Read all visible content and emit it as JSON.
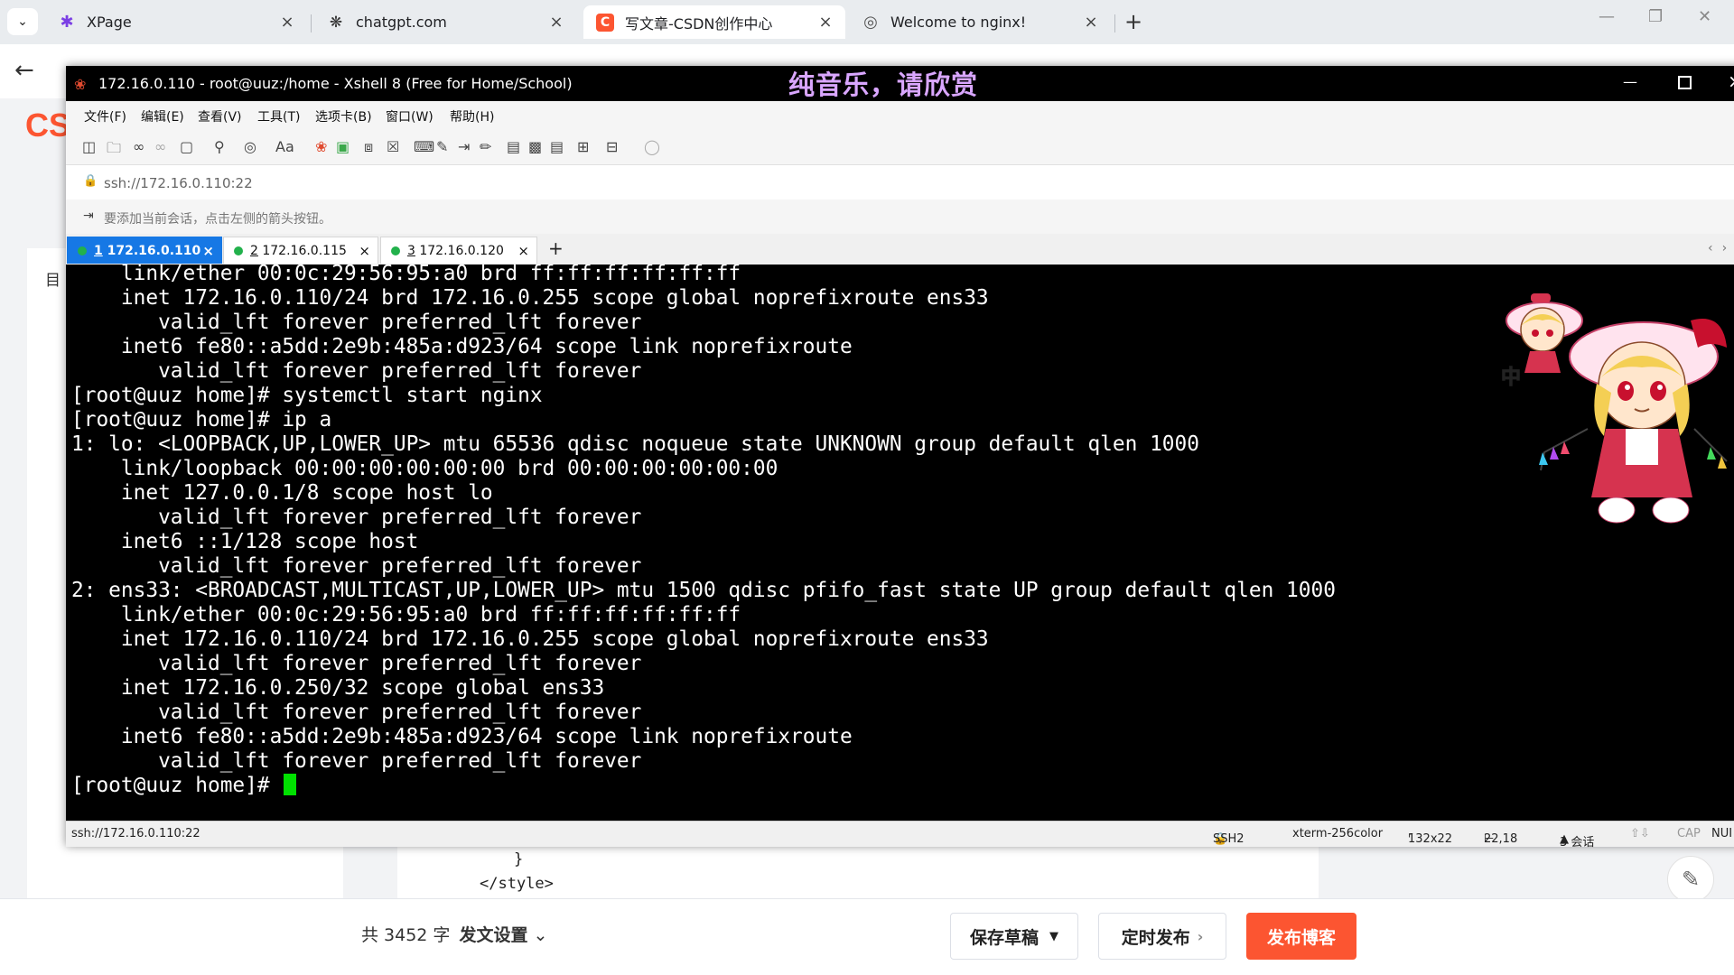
{
  "browser": {
    "tabs": [
      {
        "label": "XPage",
        "icon": "xpage-icon",
        "active": false
      },
      {
        "label": "chatgpt.com",
        "icon": "chatgpt-icon",
        "active": false
      },
      {
        "label": "写文章-CSDN创作中心",
        "icon": "csdn-icon",
        "active": true
      },
      {
        "label": "Welcome to nginx!",
        "icon": "globe-icon",
        "active": false
      }
    ],
    "new_tab": "+"
  },
  "csdn": {
    "logo": "CS",
    "side_label": "目",
    "code_lines": [
      "}",
      "</style>"
    ],
    "footer": {
      "word_count": "共 3452 字",
      "settings": "发文设置",
      "save_draft": "保存草稿",
      "schedule": "定时发布",
      "publish": "发布博客"
    },
    "colors": {
      "brand": "#fc5531"
    }
  },
  "xshell": {
    "title": "172.16.0.110 - root@uuz:/home - Xshell 8 (Free for Home/School)",
    "banner": "纯音乐，请欣赏",
    "menu": [
      "文件(F)",
      "编辑(E)",
      "查看(V)",
      "工具(T)",
      "选项卡(B)",
      "窗口(W)",
      "帮助(H)"
    ],
    "address": "ssh://172.16.0.110:22",
    "hint": "要添加当前会话，点击左侧的箭头按钮。",
    "tabs": [
      {
        "num": "1",
        "label": " 172.16.0.110",
        "active": true
      },
      {
        "num": "2",
        "label": " 172.16.0.115",
        "active": false
      },
      {
        "num": "3",
        "label": " 172.16.0.120",
        "active": false
      }
    ],
    "terminal_lines": [
      "    link/ether 00:0c:29:56:95:a0 brd ff:ff:ff:ff:ff:ff",
      "    inet 172.16.0.110/24 brd 172.16.0.255 scope global noprefixroute ens33",
      "       valid_lft forever preferred_lft forever",
      "    inet6 fe80::a5dd:2e9b:485a:d923/64 scope link noprefixroute",
      "       valid_lft forever preferred_lft forever",
      "[root@uuz home]# systemctl start nginx",
      "[root@uuz home]# ip a",
      "1: lo: <LOOPBACK,UP,LOWER_UP> mtu 65536 qdisc noqueue state UNKNOWN group default qlen 1000",
      "    link/loopback 00:00:00:00:00:00 brd 00:00:00:00:00:00",
      "    inet 127.0.0.1/8 scope host lo",
      "       valid_lft forever preferred_lft forever",
      "    inet6 ::1/128 scope host",
      "       valid_lft forever preferred_lft forever",
      "2: ens33: <BROADCAST,MULTICAST,UP,LOWER_UP> mtu 1500 qdisc pfifo_fast state UP group default qlen 1000",
      "    link/ether 00:0c:29:56:95:a0 brd ff:ff:ff:ff:ff:ff",
      "    inet 172.16.0.110/24 brd 172.16.0.255 scope global noprefixroute ens33",
      "       valid_lft forever preferred_lft forever",
      "    inet 172.16.0.250/32 scope global ens33",
      "       valid_lft forever preferred_lft forever",
      "    inet6 fe80::a5dd:2e9b:485a:d923/64 scope link noprefixroute",
      "       valid_lft forever preferred_lft forever"
    ],
    "prompt": "[root@uuz home]# ",
    "status": {
      "address": "ssh://172.16.0.110:22",
      "protocol": "SSH2",
      "term": "xterm-256color",
      "size": "132x22",
      "cursor": "22,18",
      "sessions": "3 会话",
      "cap": "CAP",
      "num": "NUI"
    },
    "colors": {
      "active_tab": "#1678e5",
      "cursor": "#00e000",
      "session_dot": "#22b14c"
    }
  },
  "pet": {
    "badge": "中"
  }
}
